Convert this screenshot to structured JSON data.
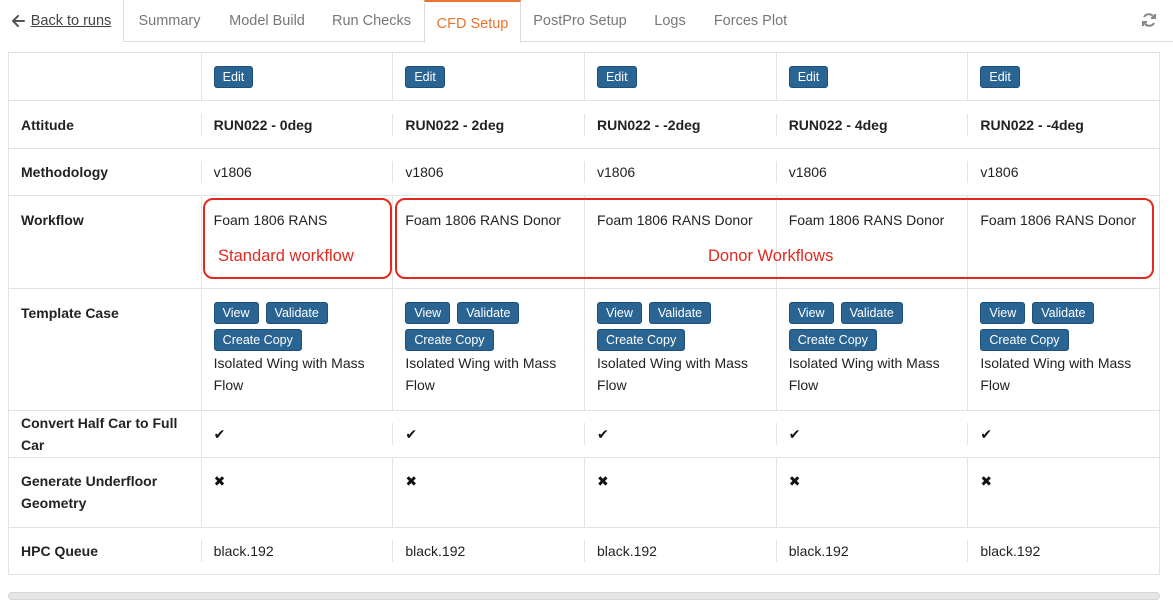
{
  "tabs": {
    "back": "Back to runs",
    "summary": "Summary",
    "model_build": "Model Build",
    "run_checks": "Run Checks",
    "cfd_setup": "CFD Setup",
    "postpro_setup": "PostPro Setup",
    "logs": "Logs",
    "forces_plot": "Forces Plot"
  },
  "colors": {
    "accent": "#e8732c",
    "button": "#2a6493",
    "annotation": "#e02a1f"
  },
  "buttons": {
    "edit": "Edit",
    "view": "View",
    "validate": "Validate",
    "create_copy": "Create Copy"
  },
  "row_labels": {
    "attitude": "Attitude",
    "methodology": "Methodology",
    "workflow": "Workflow",
    "template_case": "Template Case",
    "convert": "Convert Half Car to Full Car",
    "underfloor": "Generate Underfloor Geometry",
    "hpc_queue": "HPC Queue"
  },
  "runs": [
    {
      "attitude": "RUN022 - 0deg",
      "methodology": "v1806",
      "workflow": "Foam 1806 RANS",
      "template": "Isolated Wing with Mass Flow",
      "convert": "✔",
      "underfloor": "✖",
      "hpc": "black.192"
    },
    {
      "attitude": "RUN022 - 2deg",
      "methodology": "v1806",
      "workflow": "Foam 1806 RANS Donor",
      "template": "Isolated Wing with Mass Flow",
      "convert": "✔",
      "underfloor": "✖",
      "hpc": "black.192"
    },
    {
      "attitude": "RUN022 - -2deg",
      "methodology": "v1806",
      "workflow": "Foam 1806 RANS Donor",
      "template": "Isolated Wing with Mass Flow",
      "convert": "✔",
      "underfloor": "✖",
      "hpc": "black.192"
    },
    {
      "attitude": "RUN022 - 4deg",
      "methodology": "v1806",
      "workflow": "Foam 1806 RANS Donor",
      "template": "Isolated Wing with Mass Flow",
      "convert": "✔",
      "underfloor": "✖",
      "hpc": "black.192"
    },
    {
      "attitude": "RUN022 - -4deg",
      "methodology": "v1806",
      "workflow": "Foam 1806 RANS Donor",
      "template": "Isolated Wing with Mass Flow",
      "convert": "✔",
      "underfloor": "✖",
      "hpc": "black.192"
    }
  ],
  "annotations": {
    "standard": "Standard workflow",
    "donor": "Donor Workflows"
  }
}
